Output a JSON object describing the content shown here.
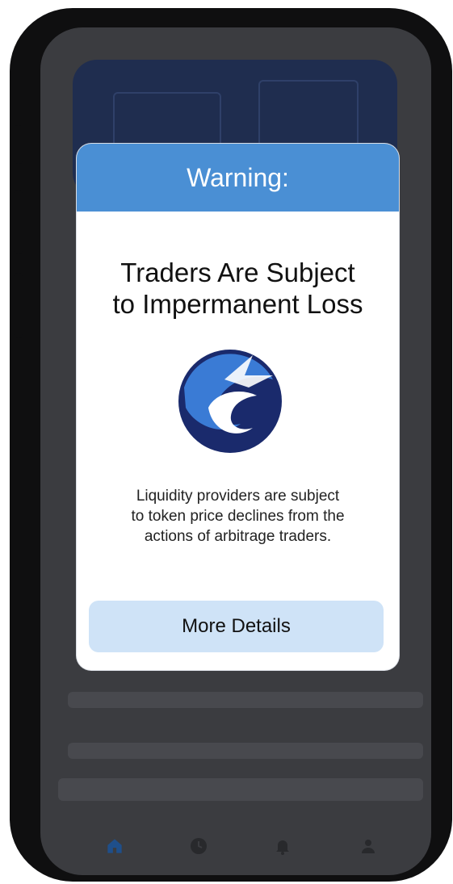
{
  "modal": {
    "header_title": "Warning:",
    "headline_line1": "Traders Are Subject",
    "headline_line2": "to Impermanent Loss",
    "body_line1": "Liquidity providers are subject",
    "body_line2": "to token price declines from the",
    "body_line3": "actions of arbitrage traders.",
    "button_label": "More Details",
    "logo_icon": "dragon-wave-logo-icon",
    "colors": {
      "header": "#4a8fd4",
      "button": "#cfe3f7",
      "logo_dark": "#1a2a6c",
      "logo_light": "#3a7bd5"
    }
  },
  "tab_bar": {
    "items": [
      {
        "icon": "home-icon",
        "active": true
      },
      {
        "icon": "clock-icon",
        "active": false
      },
      {
        "icon": "bell-icon",
        "active": false
      },
      {
        "icon": "user-icon",
        "active": false
      }
    ]
  }
}
